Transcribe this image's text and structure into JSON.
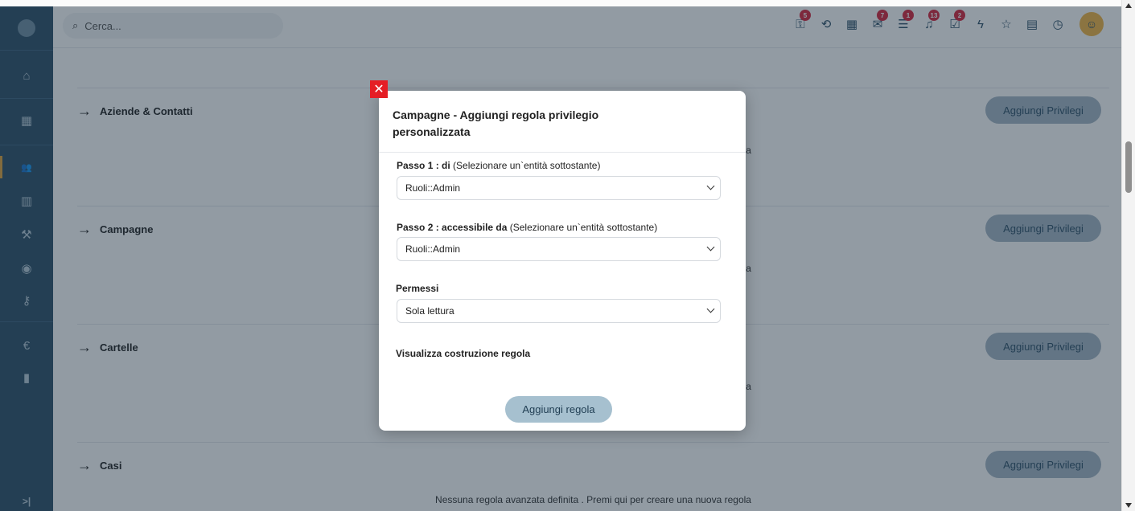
{
  "topbar": {
    "search_placeholder": "Cerca...",
    "icons": [
      {
        "name": "network-icon",
        "glyph": "⚿",
        "badge": "5"
      },
      {
        "name": "history-icon",
        "glyph": "⟲",
        "badge": ""
      },
      {
        "name": "calendar-icon",
        "glyph": "▦",
        "badge": ""
      },
      {
        "name": "mail-icon",
        "glyph": "✉",
        "badge": "7"
      },
      {
        "name": "chat-icon",
        "glyph": "☰",
        "badge": "1"
      },
      {
        "name": "bell-icon",
        "glyph": "♫",
        "badge": "13"
      },
      {
        "name": "task-icon",
        "glyph": "☑",
        "badge": "2"
      },
      {
        "name": "bolt-icon",
        "glyph": "ϟ",
        "badge": ""
      },
      {
        "name": "star-icon",
        "glyph": "☆",
        "badge": ""
      },
      {
        "name": "document-icon",
        "glyph": "▤",
        "badge": ""
      },
      {
        "name": "timer-icon",
        "glyph": "◷",
        "badge": ""
      }
    ]
  },
  "sidebar": {
    "items": [
      {
        "name": "home-icon",
        "glyph": "⌂"
      },
      {
        "name": "grid-icon",
        "glyph": "▦"
      },
      {
        "name": "users-icon",
        "glyph": "👥"
      },
      {
        "name": "building-icon",
        "glyph": "▥"
      },
      {
        "name": "gavel-icon",
        "glyph": "⚒"
      },
      {
        "name": "globe-icon",
        "glyph": "◉"
      },
      {
        "name": "wrench-icon",
        "glyph": "⚷"
      },
      {
        "name": "euro-icon",
        "glyph": "€"
      },
      {
        "name": "trash-icon",
        "glyph": "▮"
      }
    ],
    "expand_label": ">|"
  },
  "sections": [
    {
      "title": "Aziende & Contatti",
      "button": "Aggiungi Privilegi",
      "empty_text": "Nessuna regola avanzata definita . Premi qui per creare una nuova regola"
    },
    {
      "title": "Campagne",
      "button": "Aggiungi Privilegi",
      "empty_text": "Nessuna regola avanzata definita . Premi qui per creare una nuova regola"
    },
    {
      "title": "Cartelle",
      "button": "Aggiungi Privilegi",
      "empty_text": "Nessuna regola avanzata definita . Premi qui per creare una nuova regola"
    },
    {
      "title": "Casi",
      "button": "Aggiungi Privilegi",
      "empty_text": "Nessuna regola avanzata definita . Premi qui per creare una nuova regola"
    }
  ],
  "modal": {
    "close_label": "✕",
    "title": "Campagne - Aggiungi regola privilegio personalizzata",
    "step1_bold": "Passo 1 : di",
    "step1_hint": " (Selezionare un`entità sottostante)",
    "step1_value": "Ruoli::Admin",
    "step2_bold": "Passo 2 : accessibile da",
    "step2_hint": " (Selezionare un`entità sottostante)",
    "step2_value": "Ruoli::Admin",
    "permissions_label": "Permessi",
    "permissions_value": "Sola lettura",
    "preview_label": "Visualizza costruzione regola",
    "submit_label": "Aggiungi regola"
  }
}
